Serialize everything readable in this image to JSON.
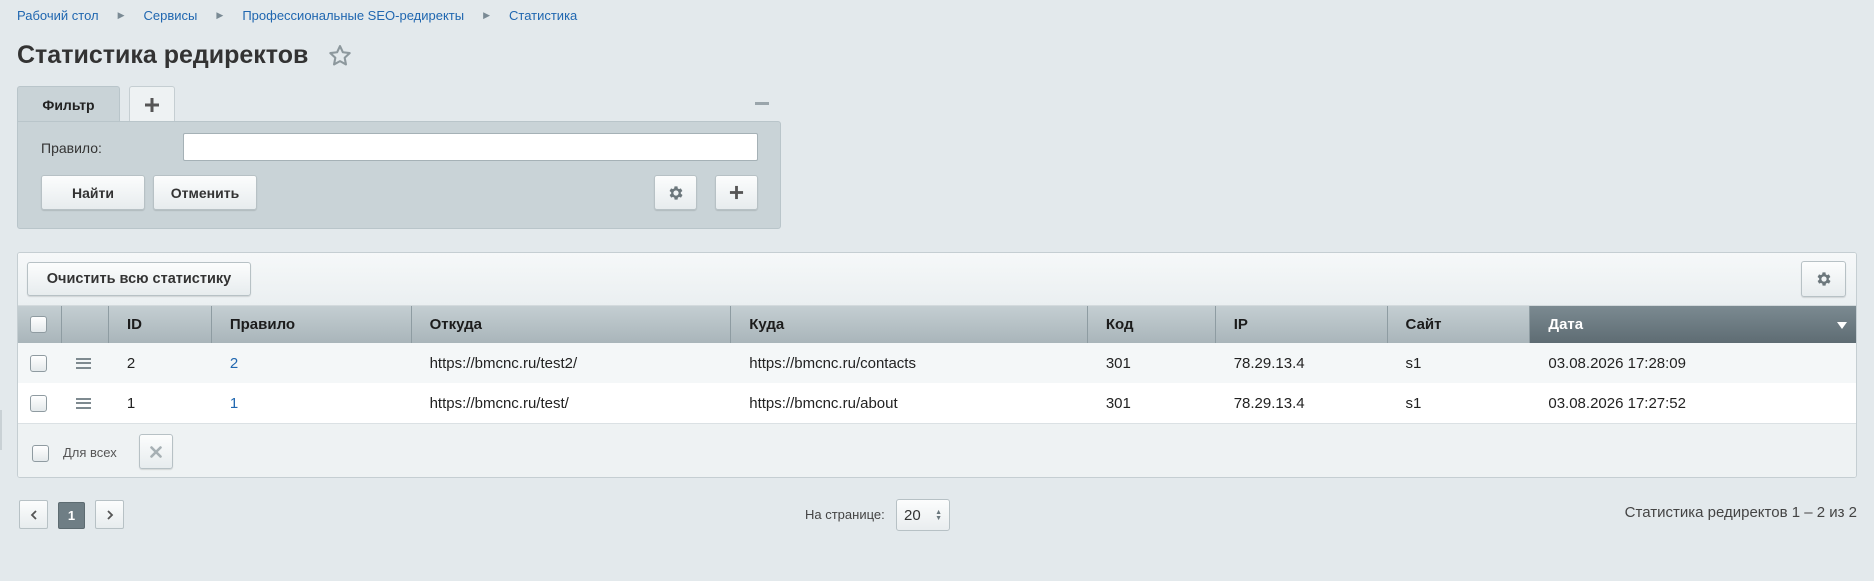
{
  "breadcrumbs": [
    "Рабочий стол",
    "Сервисы",
    "Профессиональные SEO-редиректы",
    "Статистика"
  ],
  "page_title": "Статистика редиректов",
  "filter": {
    "tab_label": "Фильтр",
    "field_label": "Правило:",
    "field_value": "",
    "find_label": "Найти",
    "cancel_label": "Отменить"
  },
  "grid": {
    "clear_label": "Очистить всю статистику",
    "columns": [
      "ID",
      "Правило",
      "Откуда",
      "Куда",
      "Код",
      "IP",
      "Сайт",
      "Дата"
    ],
    "sorted_column": "Дата",
    "rows": [
      {
        "id": "2",
        "rule": "2",
        "from": "https://bmcnc.ru/test2/",
        "to": "https://bmcnc.ru/contacts",
        "code": "301",
        "ip": "78.29.13.4",
        "site": "s1",
        "date": "03.08.2026 17:28:09"
      },
      {
        "id": "1",
        "rule": "1",
        "from": "https://bmcnc.ru/test/",
        "to": "https://bmcnc.ru/about",
        "code": "301",
        "ip": "78.29.13.4",
        "site": "s1",
        "date": "03.08.2026 17:27:52"
      }
    ],
    "for_all_label": "Для всех"
  },
  "pagination": {
    "current_page": "1",
    "per_page_label": "На странице:",
    "per_page_value": "20",
    "total_text": "Статистика редиректов 1 – 2 из 2"
  },
  "icons": [
    "star-icon",
    "plus-icon",
    "minimize-icon",
    "gear-icon",
    "menu-icon",
    "close-icon",
    "chevron-left-icon",
    "chevron-right-icon",
    "sort-desc-icon"
  ]
}
